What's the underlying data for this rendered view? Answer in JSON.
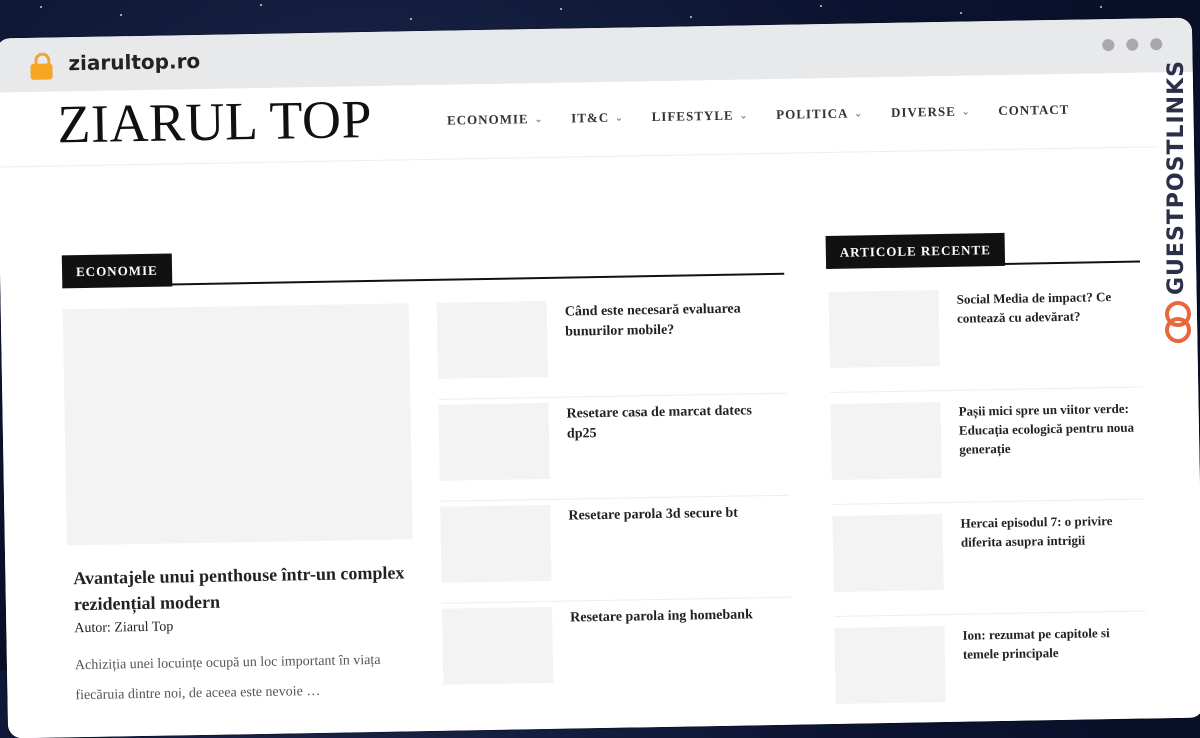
{
  "browser": {
    "url": "ziarultop.ro"
  },
  "site": {
    "logo": "ZIARUL TOP",
    "nav": [
      {
        "label": "ECONOMIE",
        "has_dropdown": true
      },
      {
        "label": "IT&C",
        "has_dropdown": true
      },
      {
        "label": "LIFESTYLE",
        "has_dropdown": true
      },
      {
        "label": "POLITICA",
        "has_dropdown": true
      },
      {
        "label": "DIVERSE",
        "has_dropdown": true
      },
      {
        "label": "CONTACT",
        "has_dropdown": false
      }
    ]
  },
  "main": {
    "section_label": "ECONOMIE",
    "featured": {
      "title": "Avantajele unui penthouse într-un complex rezidențial modern",
      "author": "Autor: Ziarul Top",
      "excerpt": "Achiziția unei locuințe ocupă un loc important în viața fiecăruia dintre noi, de aceea este nevoie …"
    },
    "list": [
      {
        "title": "Când este necesară evaluarea bunurilor mobile?"
      },
      {
        "title": "Resetare casa de marcat datecs dp25"
      },
      {
        "title": "Resetare parola 3d secure bt"
      },
      {
        "title": "Resetare parola ing homebank"
      }
    ]
  },
  "sidebar": {
    "section_label": "ARTICOLE RECENTE",
    "items": [
      {
        "title": "Social Media de impact? Ce contează cu adevărat?"
      },
      {
        "title": "Pașii mici spre un viitor verde: Educația ecologică pentru noua generație"
      },
      {
        "title": "Hercai episodul 7: o privire diferita asupra intrigii"
      },
      {
        "title": "Ion: rezumat pe capitole si temele principale"
      }
    ]
  },
  "watermark": {
    "text": "GUESTPOSTLINKS",
    "icon": "chain-link-icon",
    "accent": "#e8673c"
  },
  "colors": {
    "accent_dark": "#111111",
    "placeholder": "#f3f3f3"
  }
}
